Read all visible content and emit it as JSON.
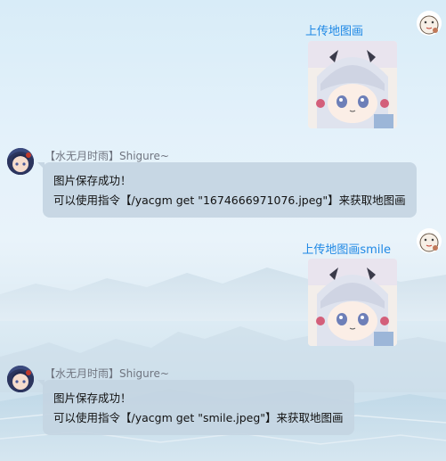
{
  "messages": [
    {
      "direction": "out",
      "sender_name": "上传地图画",
      "avatar_icon": "cartoon-sticker-avatar-icon",
      "sticker_icon": "anime-girl-sticker-icon"
    },
    {
      "direction": "in",
      "sender_name": "【水无月时雨】Shigure~",
      "avatar_icon": "anime-character-avatar-icon",
      "lines": [
        "图片保存成功！",
        "可以使用指令【/yacgm get \"1674666971076.jpeg\"】来获取地图画"
      ]
    },
    {
      "direction": "out",
      "sender_name": "上传地图画smile",
      "avatar_icon": "cartoon-sticker-avatar-icon",
      "sticker_icon": "anime-girl-sticker-icon"
    },
    {
      "direction": "in",
      "sender_name": "【水无月时雨】Shigure~",
      "avatar_icon": "anime-character-avatar-icon",
      "lines": [
        "图片保存成功！",
        "可以使用指令【/yacgm get \"smile.jpeg\"】来获取地图画"
      ]
    }
  ],
  "colors": {
    "outgoing_name": "#1e88e5",
    "incoming_name": "#707580",
    "bubble_bg": "#c4d5e2",
    "text": "#111111"
  }
}
